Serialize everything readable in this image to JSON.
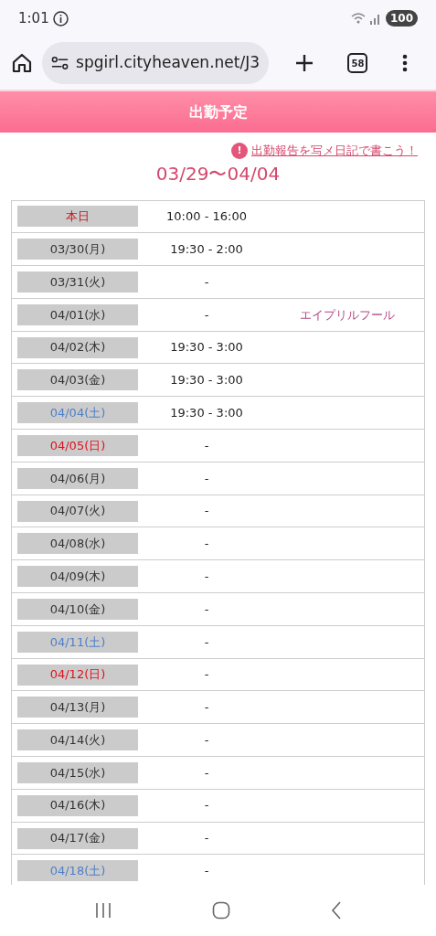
{
  "status_bar": {
    "time": "1:01",
    "battery": "100"
  },
  "browser": {
    "url": "spgirl.cityheaven.net/J3",
    "tab_count": "58"
  },
  "header": {
    "title": "出勤予定"
  },
  "diary_link": {
    "icon_text": "!",
    "text": "出勤報告を写メ日記で書こう！"
  },
  "range": "03/29〜04/04",
  "rows": [
    {
      "date": "本日",
      "kind": "today",
      "time": "10:00 - 16:00"
    },
    {
      "date": "03/30(月)",
      "kind": "weekday",
      "time": "19:30 - 2:00"
    },
    {
      "date": "03/31(火)",
      "kind": "weekday",
      "time": "-"
    },
    {
      "date": "04/01(水)",
      "kind": "weekday",
      "time": "-",
      "note": "エイプリルフール"
    },
    {
      "date": "04/02(木)",
      "kind": "weekday",
      "time": "19:30 - 3:00"
    },
    {
      "date": "04/03(金)",
      "kind": "weekday",
      "time": "19:30 - 3:00"
    },
    {
      "date": "04/04(土)",
      "kind": "saturday",
      "time": "19:30 - 3:00"
    },
    {
      "date": "04/05(日)",
      "kind": "sunday",
      "time": "-"
    },
    {
      "date": "04/06(月)",
      "kind": "weekday",
      "time": "-"
    },
    {
      "date": "04/07(火)",
      "kind": "weekday",
      "time": "-"
    },
    {
      "date": "04/08(水)",
      "kind": "weekday",
      "time": "-"
    },
    {
      "date": "04/09(木)",
      "kind": "weekday",
      "time": "-"
    },
    {
      "date": "04/10(金)",
      "kind": "weekday",
      "time": "-"
    },
    {
      "date": "04/11(土)",
      "kind": "saturday",
      "time": "-"
    },
    {
      "date": "04/12(日)",
      "kind": "sunday",
      "time": "-"
    },
    {
      "date": "04/13(月)",
      "kind": "weekday",
      "time": "-"
    },
    {
      "date": "04/14(火)",
      "kind": "weekday",
      "time": "-"
    },
    {
      "date": "04/15(水)",
      "kind": "weekday",
      "time": "-"
    },
    {
      "date": "04/16(木)",
      "kind": "weekday",
      "time": "-"
    },
    {
      "date": "04/17(金)",
      "kind": "weekday",
      "time": "-"
    },
    {
      "date": "04/18(土)",
      "kind": "saturday",
      "time": "-"
    }
  ]
}
